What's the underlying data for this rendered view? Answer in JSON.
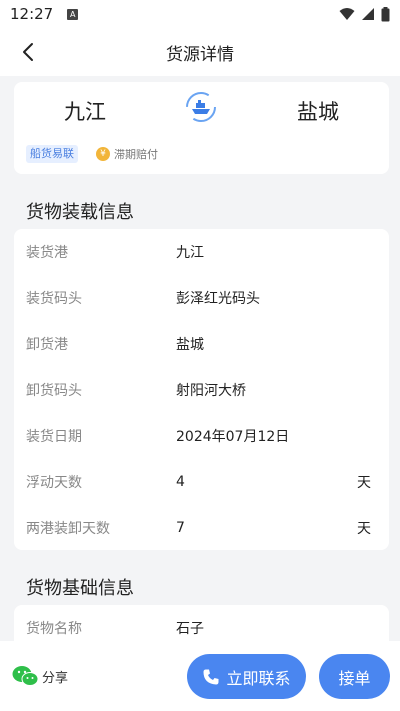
{
  "status_bar": {
    "time": "12:27",
    "notification_badge": "A",
    "icons": [
      "wifi-icon",
      "signal-icon",
      "battery-icon"
    ]
  },
  "navbar": {
    "title": "货源详情"
  },
  "route": {
    "from": "九江",
    "to": "盐城",
    "tag": "船货易联",
    "guarantee": "滞期赔付",
    "coin_symbol": "¥"
  },
  "loading_info": {
    "title": "货物装载信息",
    "rows": [
      {
        "label": "装货港",
        "value": "九江",
        "unit": ""
      },
      {
        "label": "装货码头",
        "value": "彭泽红光码头",
        "unit": ""
      },
      {
        "label": "卸货港",
        "value": "盐城",
        "unit": ""
      },
      {
        "label": "卸货码头",
        "value": "射阳河大桥",
        "unit": ""
      },
      {
        "label": "装货日期",
        "value": "2024年07月12日",
        "unit": ""
      },
      {
        "label": "浮动天数",
        "value": "4",
        "unit": "天"
      },
      {
        "label": "两港装卸天数",
        "value": "7",
        "unit": "天"
      }
    ]
  },
  "basic_info": {
    "title": "货物基础信息",
    "rows": [
      {
        "label": "货物名称",
        "value": "石子"
      }
    ]
  },
  "bottom": {
    "share_label": "分享",
    "contact_label": "立即联系",
    "accept_label": "接单"
  },
  "colors": {
    "accent": "#4a86f0",
    "tag_bg": "#e6efff",
    "coin": "#f2b53a",
    "wechat": "#2fbf4a"
  }
}
